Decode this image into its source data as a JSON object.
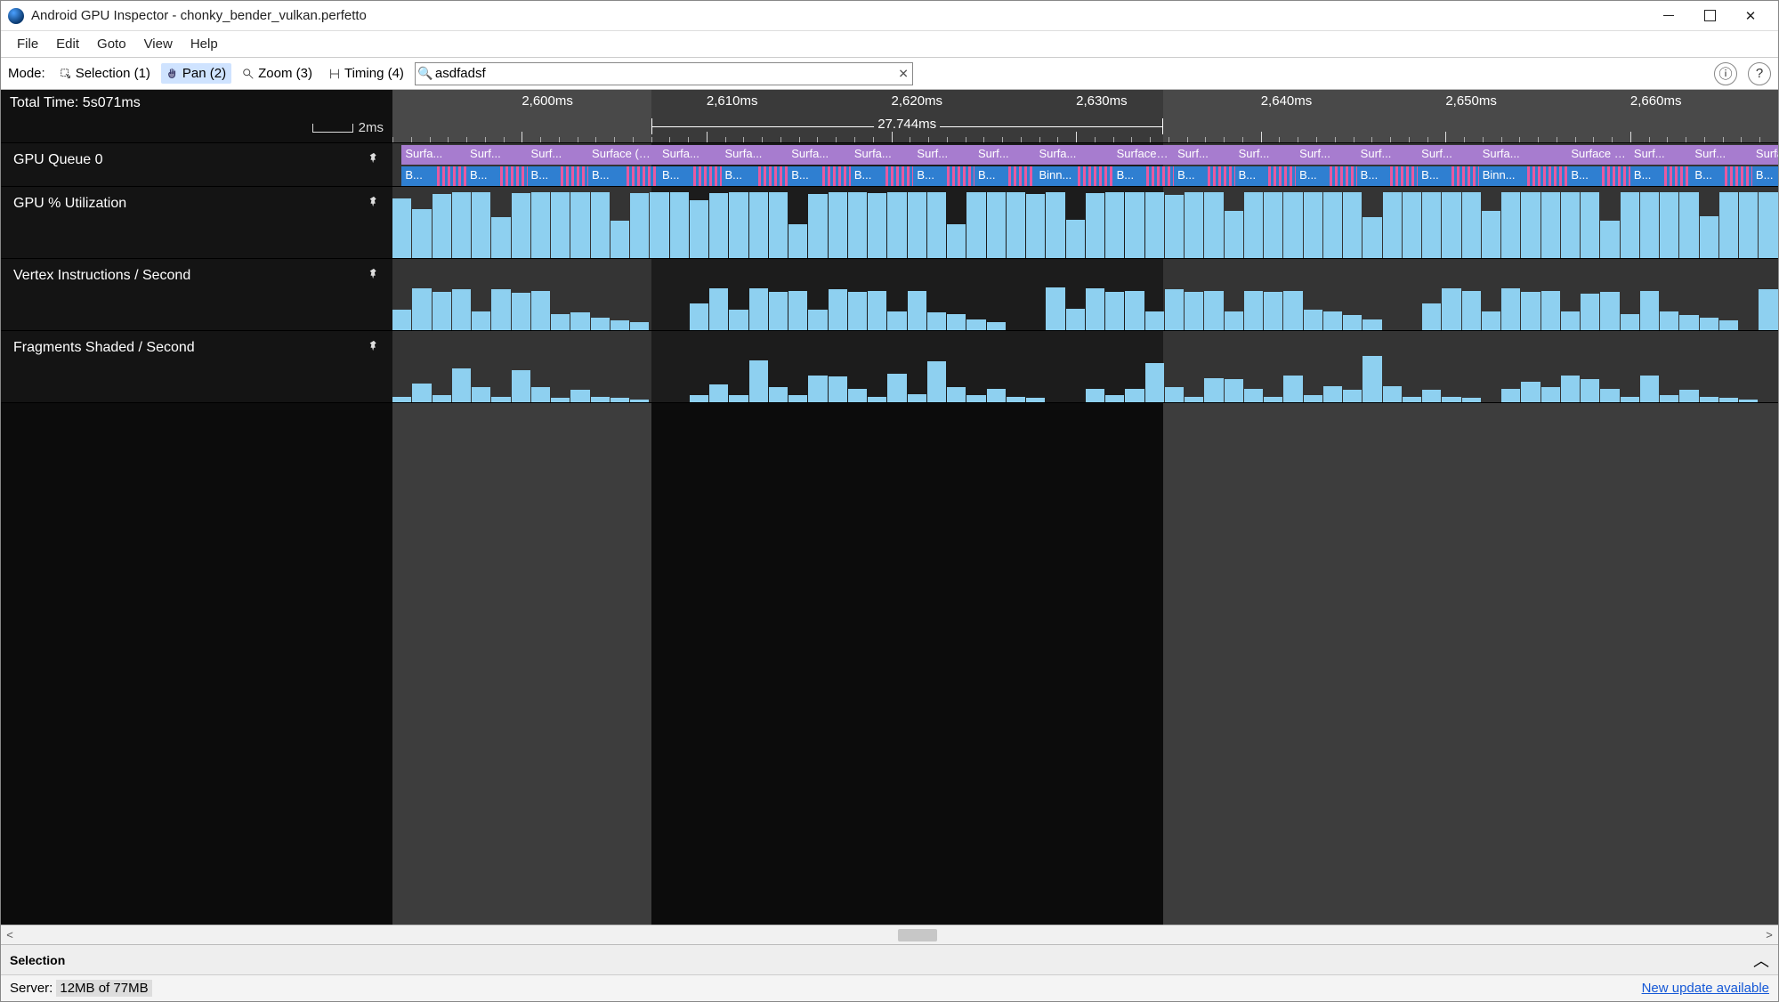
{
  "window": {
    "title": "Android GPU Inspector - chonky_bender_vulkan.perfetto"
  },
  "menu": {
    "items": [
      "File",
      "Edit",
      "Goto",
      "View",
      "Help"
    ]
  },
  "toolbar": {
    "mode_label": "Mode:",
    "modes": [
      {
        "label": "Selection (1)",
        "icon": "selection"
      },
      {
        "label": "Pan (2)",
        "icon": "pan",
        "active": true
      },
      {
        "label": "Zoom (3)",
        "icon": "zoom"
      },
      {
        "label": "Timing (4)",
        "icon": "timing"
      }
    ],
    "search_value": "asdfadsf"
  },
  "ruler": {
    "total_time": "Total Time: 5s071ms",
    "scale_label": "2ms",
    "ticks_ms": [
      2600,
      2610,
      2620,
      2630,
      2640,
      2650,
      2660
    ],
    "range_label": "27.744ms",
    "selection_start_ms": 2607.0,
    "selection_end_ms": 2634.7,
    "view_start_ms": 2593.0,
    "view_end_ms": 2668.0
  },
  "tracks": {
    "gpu_queue_label": "GPU Queue 0",
    "gpu_util_label": "GPU % Utilization",
    "vertex_label": "Vertex Instructions / Second",
    "frag_label": "Fragments Shaded / Second"
  },
  "blocks": {
    "surf": "Surf...",
    "surfa": "Surfa...",
    "surface10": "Surface (10...",
    "binn": "Binn...",
    "b": "B..."
  },
  "chart_data": [
    {
      "type": "bar",
      "name": "GPU % Utilization",
      "ylim": [
        0,
        100
      ],
      "values": [
        88,
        72,
        95,
        98,
        97,
        60,
        96,
        98,
        98,
        98,
        97,
        55,
        96,
        98,
        97,
        85,
        96,
        98,
        98,
        97,
        50,
        95,
        97,
        98,
        96,
        97,
        98,
        98,
        50,
        97,
        98,
        97,
        95,
        98,
        56,
        96,
        98,
        98,
        97,
        94,
        97,
        98,
        70,
        97,
        98,
        97,
        98,
        97,
        97,
        60,
        98,
        98,
        97,
        98,
        98,
        70,
        98,
        98,
        98,
        98,
        97,
        55,
        98,
        98,
        97,
        98,
        62,
        97,
        98,
        98
      ]
    },
    {
      "type": "bar",
      "name": "Vertex Instructions / Second",
      "ylim": [
        0,
        100
      ],
      "values": [
        30,
        62,
        56,
        60,
        28,
        60,
        55,
        58,
        24,
        26,
        18,
        14,
        12,
        0,
        0,
        40,
        62,
        30,
        62,
        56,
        58,
        30,
        60,
        56,
        58,
        28,
        58,
        26,
        24,
        16,
        12,
        0,
        0,
        63,
        32,
        62,
        56,
        58,
        28,
        60,
        56,
        58,
        28,
        58,
        56,
        58,
        30,
        28,
        22,
        16,
        0,
        0,
        40,
        62,
        58,
        28,
        62,
        56,
        58,
        28,
        54,
        56,
        24,
        58,
        28,
        22,
        18,
        14,
        0,
        60
      ]
    },
    {
      "type": "bar",
      "name": "Fragments Shaded / Second",
      "ylim": [
        0,
        100
      ],
      "values": [
        8,
        28,
        10,
        50,
        22,
        8,
        48,
        22,
        6,
        18,
        8,
        6,
        4,
        0,
        0,
        10,
        26,
        10,
        62,
        22,
        10,
        40,
        38,
        20,
        8,
        42,
        12,
        60,
        22,
        10,
        20,
        8,
        6,
        0,
        0,
        20,
        10,
        20,
        58,
        22,
        8,
        36,
        34,
        20,
        8,
        40,
        10,
        24,
        18,
        68,
        24,
        8,
        18,
        8,
        6,
        0,
        20,
        30,
        22,
        40,
        34,
        20,
        8,
        40,
        10,
        18,
        8,
        6,
        4,
        0
      ]
    }
  ],
  "selection_panel": {
    "title": "Selection"
  },
  "status": {
    "server_label": "Server:",
    "server_mem": "12MB of 77MB",
    "update_link": "New update available"
  },
  "scrollbar": {
    "thumb_left_pct": 50.5,
    "thumb_width_pct": 2.2
  }
}
